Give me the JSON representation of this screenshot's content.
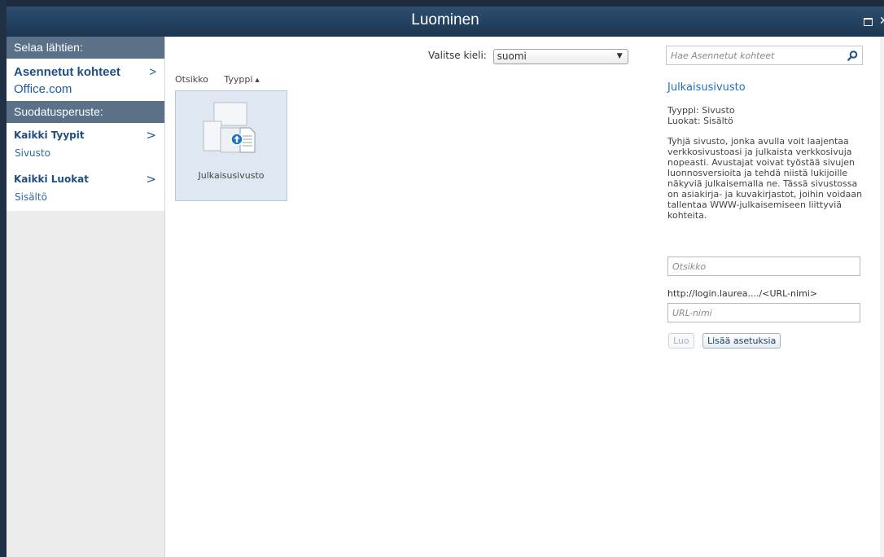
{
  "window": {
    "title": "Luominen"
  },
  "nav": {
    "browse_header": "Selaa lähtien:",
    "sources": [
      {
        "label": "Asennetut kohteet",
        "selected": true
      },
      {
        "label": "Office.com",
        "selected": false
      }
    ],
    "filter_header": "Suodatusperuste:",
    "filters": [
      {
        "label": "Kaikki Tyypit",
        "items": [
          "Sivusto"
        ]
      },
      {
        "label": "Kaikki Luokat",
        "items": [
          "Sisältö"
        ]
      }
    ]
  },
  "main": {
    "language_label": "Valitse kieli:",
    "language_value": "suomi",
    "sort": {
      "title": "Otsikko",
      "type": "Tyyppi"
    },
    "templates": [
      {
        "label": "Julkaisusivusto"
      }
    ]
  },
  "details": {
    "search_placeholder": "Hae Asennetut kohteet",
    "title": "Julkaisusivusto",
    "type_line": "Tyyppi: Sivusto",
    "category_line": "Luokat: Sisältö",
    "description": "Tyhjä sivusto, jonka avulla voit laajentaa verkkosivustoasi ja julkaista verkkosivuja nopeasti. Avustajat voivat työstää sivujen luonnosversioita ja tehdä niistä lukijoille näkyviä julkaisemalla ne. Tässä sivustossa on asiakirja- ja kuvakirjastot, joihin voidaan tallentaa WWW-julkaisemiseen liittyviä kohteita.",
    "title_placeholder": "Otsikko",
    "url_prefix": "http://login.laurea..../<URL-nimi>",
    "url_placeholder": "URL-nimi",
    "create_label": "Luo",
    "more_label": "Lisää asetuksia"
  },
  "colors": {
    "titlebar": "#23405f",
    "nav_header": "#5b7188",
    "link": "#1f5c9a",
    "tile_bg": "#dfe8f2",
    "accent_title": "#1f6fbf"
  }
}
